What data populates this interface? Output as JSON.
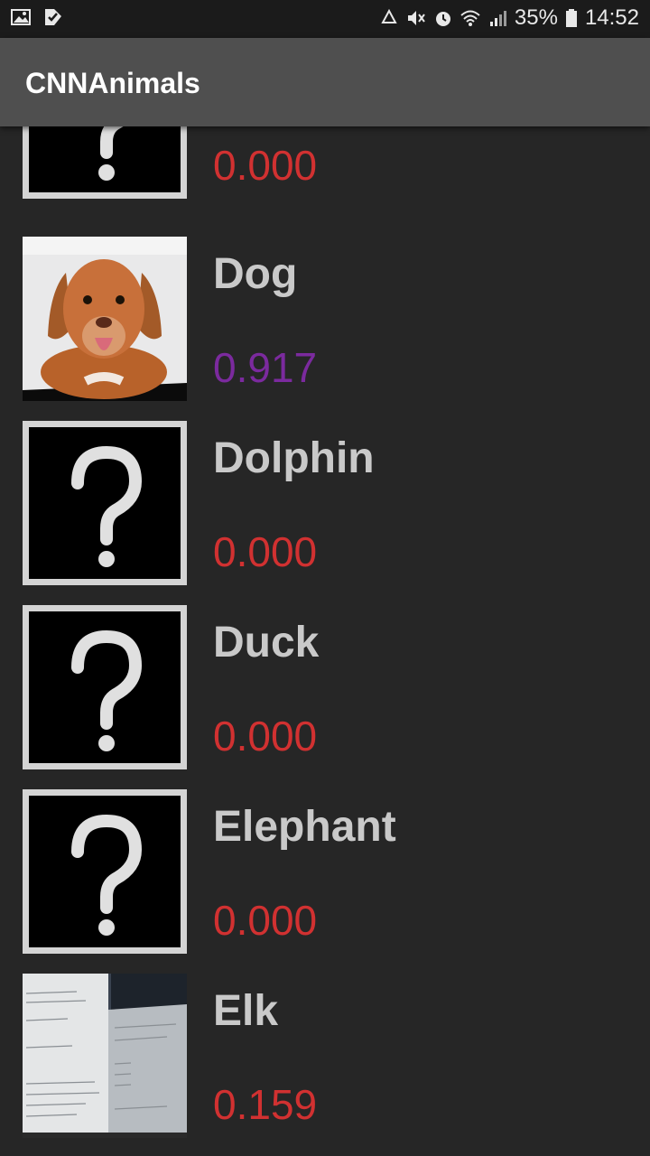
{
  "status_bar": {
    "battery": "35%",
    "time": "14:52",
    "left_icons": [
      "image-icon",
      "check-notification-icon"
    ],
    "right_icons": [
      "recycle-icon",
      "mute-icon",
      "alarm-icon",
      "wifi-icon",
      "signal-icon",
      "battery-icon"
    ]
  },
  "app_bar": {
    "title": "CNNAnimals"
  },
  "list": {
    "items": [
      {
        "label": "",
        "score": "0.000",
        "thumb": "question-mark"
      },
      {
        "label": "Dog",
        "score": "0.917",
        "thumb": "dog-photo",
        "score_color": "#7b2a9e"
      },
      {
        "label": "Dolphin",
        "score": "0.000",
        "thumb": "question-mark"
      },
      {
        "label": "Duck",
        "score": "0.000",
        "thumb": "question-mark"
      },
      {
        "label": "Elephant",
        "score": "0.000",
        "thumb": "question-mark"
      },
      {
        "label": "Elk",
        "score": "0.159",
        "thumb": "screen-photo"
      }
    ]
  },
  "colors": {
    "background": "#262626",
    "app_bar": "#4f4f4f",
    "status_bar": "#1b1b1b",
    "label": "#c9c9c9",
    "score_low": "#d13131",
    "score_high": "#7b2a9e"
  }
}
